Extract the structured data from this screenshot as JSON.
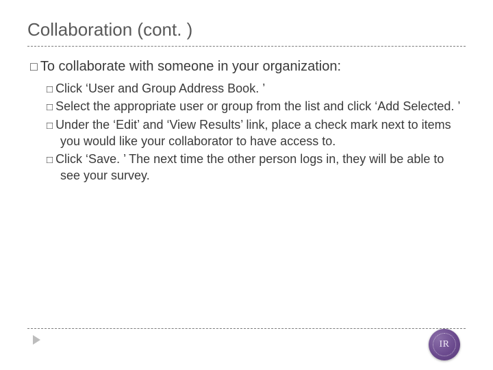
{
  "title": "Collaboration (cont. )",
  "outer": {
    "text": "To collaborate with someone in your organization:"
  },
  "inner": [
    "Click ‘User and Group Address Book. ’",
    "Select the appropriate user or group from the list and click ‘Add Selected. ’",
    "Under the ‘Edit’ and ‘View Results’ link, place a check mark next to items you would like your collaborator to have access to.",
    "Click ‘Save. ’ The next time the other person logs in, they will be able to see your survey."
  ],
  "badge": "IR",
  "bullet_glyph": "□"
}
